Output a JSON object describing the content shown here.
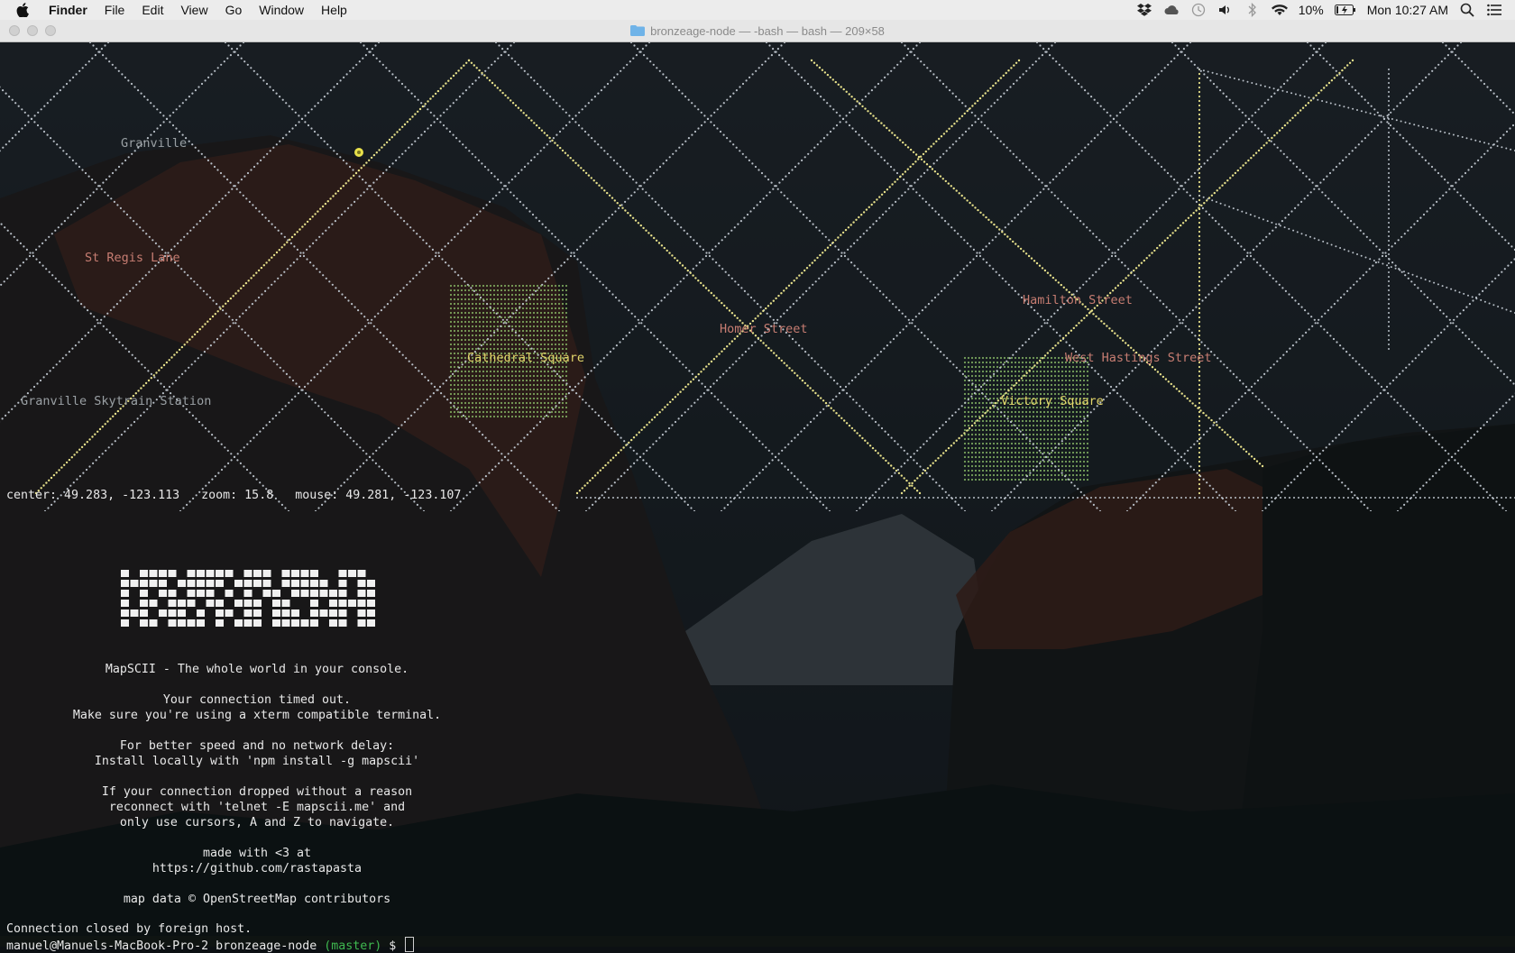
{
  "menubar": {
    "app": "Finder",
    "items": [
      "File",
      "Edit",
      "View",
      "Go",
      "Window",
      "Help"
    ],
    "battery": "10%",
    "clock": "Mon 10:27 AM"
  },
  "window": {
    "title": "bronzeage-node — -bash — bash — 209×58"
  },
  "map": {
    "labels": [
      {
        "text": "Granville",
        "color": "#9aa0a4"
      },
      {
        "text": "St Regis Lane",
        "color": "#c77d72"
      },
      {
        "text": "Cathedral Square",
        "color": "#e1d46a"
      },
      {
        "text": "Homer Street",
        "color": "#c77d72"
      },
      {
        "text": "Hamilton Street",
        "color": "#c77d72"
      },
      {
        "text": "West Hastings Street",
        "color": "#c77d72"
      },
      {
        "text": "Victory Square",
        "color": "#e1d46a"
      },
      {
        "text": "Granville Skytrain Station",
        "color": "#9aa0a4"
      }
    ],
    "colors": {
      "street": "#b9c0c8",
      "main_road": "#e6e08a",
      "park": "#8fc46b",
      "poi": "#e8e04a"
    }
  },
  "status_line": {
    "text": "center: 49.283, -123.113   zoom: 15.8   mouse: 49.281, -123.107"
  },
  "info": {
    "lines": [
      "MapSCII - The whole world in your console.",
      "",
      "Your connection timed out.",
      "Make sure you're using a xterm compatible terminal.",
      "",
      "For better speed and no network delay:",
      "Install locally with 'npm install -g mapscii'",
      "",
      "If your connection dropped without a reason",
      "reconnect with 'telnet -E mapscii.me' and",
      "only use cursors, A and Z to navigate.",
      "",
      "made with <3 at",
      "https://github.com/rastapasta",
      "",
      "map data © OpenStreetMap contributors"
    ]
  },
  "footer": {
    "closed": "Connection closed by foreign host.",
    "prompt_user": "manuel@Manuels-MacBook-Pro-2 bronzeage-node ",
    "prompt_branch": "(master)",
    "prompt_symbol": " $ "
  }
}
